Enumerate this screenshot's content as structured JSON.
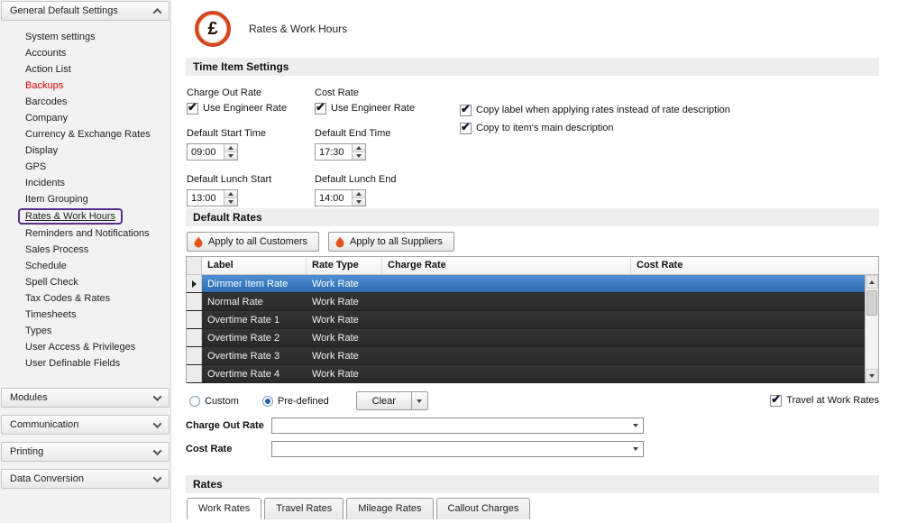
{
  "sidebar": {
    "sections": [
      {
        "label": "General Default Settings",
        "items": [
          "System settings",
          "Accounts",
          "Action List",
          "Backups",
          "Barcodes",
          "Company",
          "Currency & Exchange Rates",
          "Display",
          "GPS",
          "Incidents",
          "Item Grouping",
          "Rates & Work Hours",
          "Reminders and Notifications",
          "Sales Process",
          "Schedule",
          "Spell Check",
          "Tax Codes & Rates",
          "Timesheets",
          "Types",
          "User Access & Privileges",
          "User Definable Fields"
        ]
      },
      {
        "label": "Modules"
      },
      {
        "label": "Communication"
      },
      {
        "label": "Printing"
      },
      {
        "label": "Data Conversion"
      }
    ],
    "highlight_color": "#5b2d8e",
    "backups_color": "#d80000"
  },
  "header": {
    "title": "Rates & Work Hours",
    "currency_symbol": "£"
  },
  "time_item_settings": {
    "section_title": "Time Item Settings",
    "charge_out_rate_label": "Charge Out Rate",
    "cost_rate_label": "Cost Rate",
    "use_engineer_rate_label": "Use Engineer Rate",
    "copy_label_text": "Copy label when applying rates instead of rate description",
    "copy_description_text": "Copy to item's main description",
    "default_start_time_label": "Default Start Time",
    "default_start_time_value": "09:00",
    "default_end_time_label": "Default End Time",
    "default_end_time_value": "17:30",
    "default_lunch_start_label": "Default Lunch Start",
    "default_lunch_start_value": "13:00",
    "default_lunch_end_label": "Default Lunch End",
    "default_lunch_end_value": "14:00"
  },
  "default_rates": {
    "section_title": "Default Rates",
    "apply_customers_label": "Apply to all Customers",
    "apply_suppliers_label": "Apply to all Suppliers",
    "table": {
      "columns": [
        "Label",
        "Rate Type",
        "Charge Rate",
        "Cost Rate"
      ],
      "rows": [
        {
          "label": "Dimmer Item Rate",
          "rate_type": "Work Rate",
          "charge_rate": "",
          "cost_rate": ""
        },
        {
          "label": "Normal Rate",
          "rate_type": "Work Rate",
          "charge_rate": "",
          "cost_rate": ""
        },
        {
          "label": "Overtime Rate 1",
          "rate_type": "Work Rate",
          "charge_rate": "",
          "cost_rate": ""
        },
        {
          "label": "Overtime Rate 2",
          "rate_type": "Work Rate",
          "charge_rate": "",
          "cost_rate": ""
        },
        {
          "label": "Overtime Rate 3",
          "rate_type": "Work Rate",
          "charge_rate": "",
          "cost_rate": ""
        },
        {
          "label": "Overtime Rate 4",
          "rate_type": "Work Rate",
          "charge_rate": "",
          "cost_rate": ""
        }
      ],
      "selected_row": 0
    },
    "custom_label": "Custom",
    "predefined_label": "Pre-defined",
    "clear_button_label": "Clear",
    "travel_at_work_rates_label": "Travel at Work Rates",
    "charge_out_rate_label": "Charge Out Rate",
    "charge_out_rate_value": "",
    "cost_rate_label": "Cost Rate",
    "cost_rate_value": ""
  },
  "rates": {
    "section_title": "Rates",
    "tabs": [
      "Work Rates",
      "Travel Rates",
      "Mileage Rates",
      "Callout Charges"
    ],
    "active_tab": "Work Rates"
  },
  "colors": {
    "accent_orange": "#e2561c",
    "selected_row_blue": "#3c7fc6",
    "grid_dark": "#2e2e2e"
  }
}
